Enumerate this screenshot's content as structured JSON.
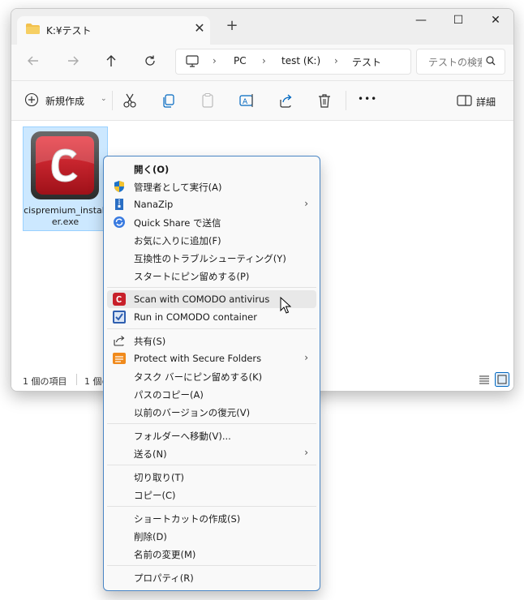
{
  "window": {
    "tab_title": "K:¥テスト",
    "tab_close": "✕",
    "new_tab": "+",
    "controls": {
      "minimize": "—",
      "maximize": "☐",
      "close": "✕"
    }
  },
  "address": {
    "segments": [
      "PC",
      "test (K:)",
      "テスト"
    ],
    "separator": "›"
  },
  "search": {
    "placeholder": "テストの検索"
  },
  "toolbar": {
    "new_label": "新規作成",
    "new_dropdown": "⌄",
    "more_label": "•••",
    "details_label": "詳細"
  },
  "file": {
    "name": "cispremium_installer.exe"
  },
  "status": {
    "count": "1 個の項目",
    "selected": "1 個の"
  },
  "context_menu": {
    "items": [
      {
        "label": "開く(O)",
        "bold": true
      },
      {
        "label": "管理者として実行(A)"
      },
      {
        "label": "NanaZip"
      },
      {
        "label": "Quick Share で送信"
      },
      {
        "label": "お気に入りに追加(F)"
      },
      {
        "label": "互換性のトラブルシューティング(Y)"
      },
      {
        "label": "スタートにピン留めする(P)"
      },
      {
        "label": "Scan with COMODO antivirus"
      },
      {
        "label": "Run in COMODO container"
      },
      {
        "label": "共有(S)"
      },
      {
        "label": "Protect with Secure Folders"
      },
      {
        "label": "タスク バーにピン留めする(K)"
      },
      {
        "label": "パスのコピー(A)"
      },
      {
        "label": "以前のバージョンの復元(V)"
      },
      {
        "label": "フォルダーへ移動(V)..."
      },
      {
        "label": "送る(N)"
      },
      {
        "label": "切り取り(T)"
      },
      {
        "label": "コピー(C)"
      },
      {
        "label": "ショートカットの作成(S)"
      },
      {
        "label": "削除(D)"
      },
      {
        "label": "名前の変更(M)"
      },
      {
        "label": "プロパティ(R)"
      }
    ],
    "submenu_arrow": "›"
  },
  "colors": {
    "accent": "#0067c0",
    "selection": "#cce8ff",
    "menu_border": "#4a86c5",
    "comodo_red": "#c8202a"
  },
  "icons": [
    "folder-icon",
    "close-icon",
    "plus-icon",
    "back-icon",
    "forward-icon",
    "up-icon",
    "refresh-icon",
    "computer-icon",
    "search-icon",
    "new-icon",
    "cut-icon",
    "copy-icon",
    "paste-icon",
    "rename-icon",
    "share-icon",
    "delete-icon",
    "more-icon",
    "details-icon",
    "comodo-app-icon"
  ]
}
